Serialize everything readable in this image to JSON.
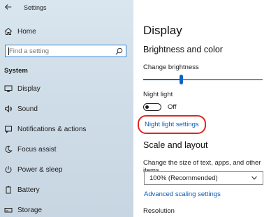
{
  "window": {
    "title": "Settings"
  },
  "sidebar": {
    "home_label": "Home",
    "search_placeholder": "Find a setting",
    "section_title": "System",
    "items": [
      {
        "label": "Display",
        "icon": "monitor-icon"
      },
      {
        "label": "Sound",
        "icon": "speaker-icon"
      },
      {
        "label": "Notifications & actions",
        "icon": "notification-icon"
      },
      {
        "label": "Focus assist",
        "icon": "moon-icon"
      },
      {
        "label": "Power & sleep",
        "icon": "power-icon"
      },
      {
        "label": "Battery",
        "icon": "battery-icon"
      },
      {
        "label": "Storage",
        "icon": "storage-icon"
      }
    ]
  },
  "main": {
    "page_title": "Display",
    "brightness_section": {
      "heading": "Brightness and color",
      "change_brightness_label": "Change brightness",
      "brightness_level": 0.32,
      "night_light_label": "Night light",
      "night_light_state": "Off",
      "night_light_settings_link": "Night light settings"
    },
    "scale_section": {
      "heading": "Scale and layout",
      "size_label": "Change the size of text, apps, and other items",
      "size_value": "100% (Recommended)",
      "advanced_link": "Advanced scaling settings",
      "resolution_label": "Resolution"
    }
  },
  "colors": {
    "accent": "#0a63c9",
    "link": "#0a5bb5",
    "highlight": "#e0261e"
  }
}
